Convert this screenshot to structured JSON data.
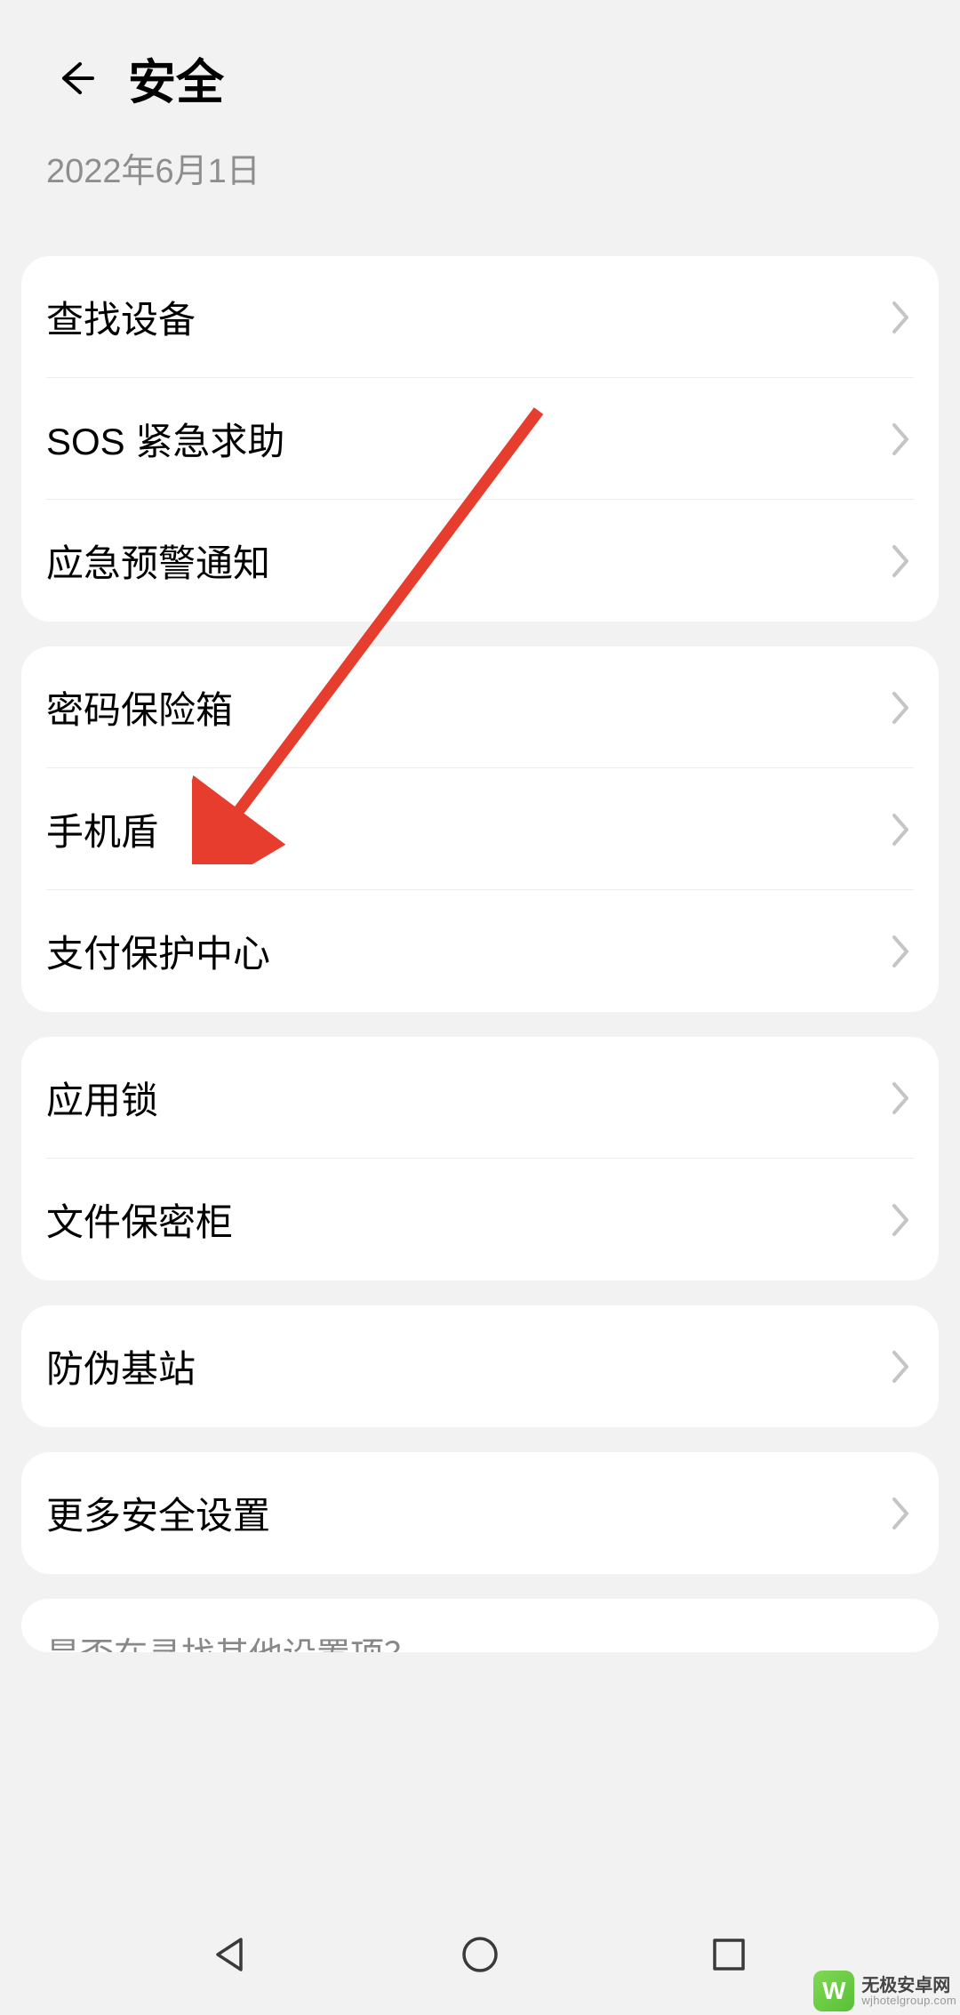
{
  "header": {
    "title": "安全"
  },
  "date": "2022年6月1日",
  "groups": [
    {
      "items": [
        "查找设备",
        "SOS 紧急求助",
        "应急预警通知"
      ]
    },
    {
      "items": [
        "密码保险箱",
        "手机盾",
        "支付保护中心"
      ]
    },
    {
      "items": [
        "应用锁",
        "文件保密柜"
      ]
    },
    {
      "items": [
        "防伪基站"
      ]
    },
    {
      "items": [
        "更多安全设置"
      ]
    }
  ],
  "partial_text": "是否在寻找其他设置项？",
  "watermark": {
    "main": "无极安卓网",
    "sub": "wjhotelgroup.com"
  }
}
